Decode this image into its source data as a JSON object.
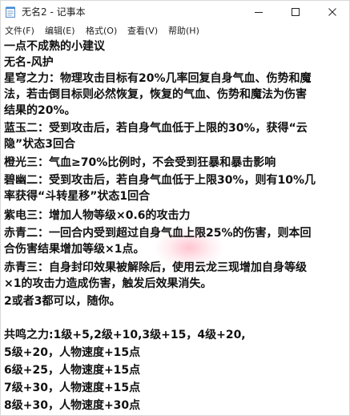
{
  "window": {
    "title": "无名2 - 记事本"
  },
  "menu": {
    "file": "文件(F)",
    "edit": "编辑(E)",
    "format": "格式(O)",
    "view": "查看(V)",
    "help": "帮助(H)"
  },
  "icons": {
    "app": "notepad-icon",
    "minimize": "minimize-icon",
    "maximize": "maximize-icon",
    "close": "close-icon"
  },
  "colors": {
    "text": "#111111",
    "background": "#ffffff"
  },
  "content": {
    "lines": [
      "一点不成熟的小建议",
      "无名-风护",
      "星穹之力：物理攻击目标有20%几率回复自身气血、伤势和魔",
      "法，若击倒目标则必然恢复，恢复的气血、伤势和魔法为伤害",
      "结果的20%。",
      "蓝玉二：受到攻击后，若自身气血低于上限的30%，获得“云",
      "隐”状态3回合",
      "橙光三：气血≥70%比例时，不会受到狂暴和暴击影响",
      "碧幽二：受到攻击后，若自身气血低于上限30%，则有10%几",
      "率获得“斗转星移”状态1回合",
      "紫电三：增加人物等级×0.6的攻击力",
      "赤青二：一回合内受到超过自身气血上限25%的伤害，则本回",
      "合伤害结果增加等级×1点。",
      "赤青三：自身封印效果被解除后，使用云龙三现增加自身等级",
      "×1的攻击力造成伤害，触发后效果消失。",
      "2或者3都可以，随你。",
      "",
      "共鸣之力:1级+5,2级+10,3级+15，4级+20,",
      "5级+20，人物速度+15点",
      "6级+25，人物速度+15点",
      "7级+30，人物速度+15点",
      "8级+30，人物速度+30点"
    ]
  }
}
